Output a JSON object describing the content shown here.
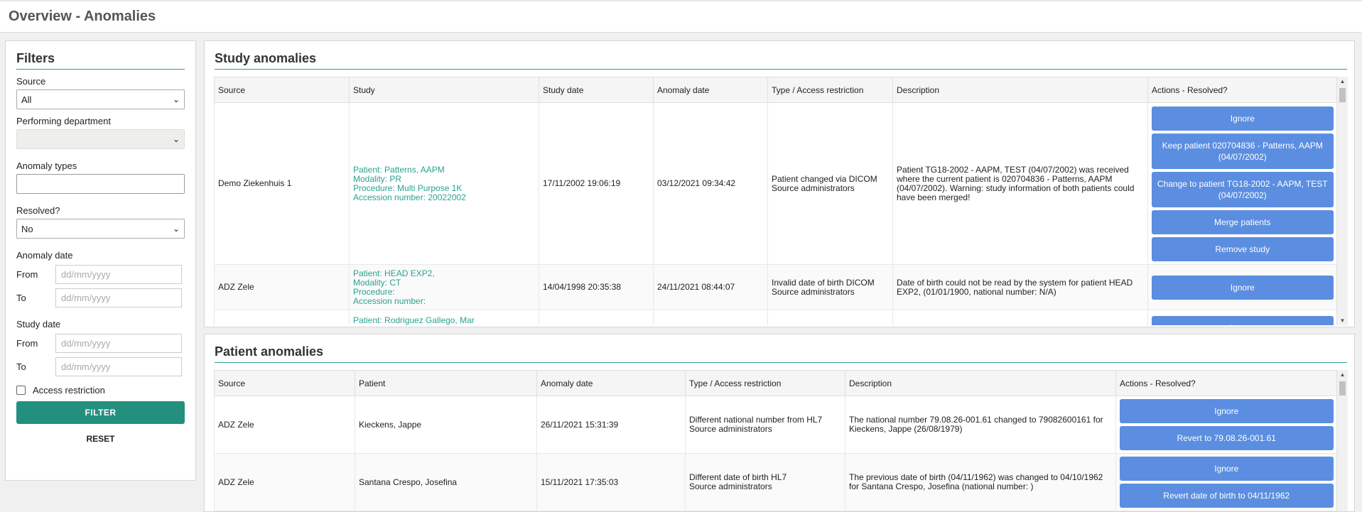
{
  "header": {
    "title": "Overview - Anomalies"
  },
  "filters": {
    "title": "Filters",
    "source_label": "Source",
    "source_value": "All",
    "department_label": "Performing department",
    "department_value": "",
    "anomaly_types_label": "Anomaly types",
    "resolved_label": "Resolved?",
    "resolved_value": "No",
    "anomaly_date_label": "Anomaly date",
    "study_date_label": "Study date",
    "from_label": "From",
    "to_label": "To",
    "date_placeholder": "dd/mm/yyyy",
    "access_restriction_label": "Access restriction",
    "filter_button": "FILTER",
    "reset_button": "RESET"
  },
  "study_anomalies": {
    "title": "Study anomalies",
    "columns": [
      "Source",
      "Study",
      "Study date",
      "Anomaly date",
      "Type / Access restriction",
      "Description",
      "Actions - Resolved?"
    ],
    "rows": [
      {
        "source": "Demo Ziekenhuis 1",
        "patient": "Patient: Patterns, AAPM",
        "modality": "Modality: PR",
        "procedure": "Procedure: Multi Purpose 1K",
        "accession": "Accession number: 20022002",
        "study_date": "17/11/2002 19:06:19",
        "anomaly_date": "03/12/2021 09:34:42",
        "type": "Patient changed via DICOM",
        "access": "Source administrators",
        "description": "Patient TG18-2002 - AAPM, TEST (04/07/2002) was received where the current patient is 020704836 - Patterns, AAPM (04/07/2002). Warning: study information of both patients could have been merged!",
        "actions": [
          "Ignore",
          "Keep patient 020704836 - Patterns, AAPM (04/07/2002)",
          "Change to patient TG18-2002 - AAPM, TEST (04/07/2002)",
          "Merge patients",
          "Remove study"
        ]
      },
      {
        "source": "ADZ Zele",
        "patient": "Patient: HEAD EXP2,",
        "modality": "Modality: CT",
        "procedure": "Procedure:",
        "accession": "Accession number:",
        "study_date": "14/04/1998 20:35:38",
        "anomaly_date": "24/11/2021 08:44:07",
        "type": "Invalid date of birth DICOM",
        "access": "Source administrators",
        "description": "Date of birth could not be read by the system for patient HEAD EXP2, (01/01/1900, national number: N/A)",
        "actions": [
          "Ignore"
        ]
      },
      {
        "source": "",
        "patient": "Patient: Rodriguez Gallego, Mar",
        "modality": "",
        "procedure": "",
        "accession": "",
        "study_date": "",
        "anomaly_date": "",
        "type": "",
        "access": "",
        "description": "",
        "actions": [
          "Ignore"
        ]
      }
    ]
  },
  "patient_anomalies": {
    "title": "Patient anomalies",
    "columns": [
      "Source",
      "Patient",
      "Anomaly date",
      "Type / Access restriction",
      "Description",
      "Actions - Resolved?"
    ],
    "rows": [
      {
        "source": "ADZ Zele",
        "patient": "Kieckens, Jappe",
        "anomaly_date": "26/11/2021 15:31:39",
        "type": "Different national number from HL7",
        "access": "Source administrators",
        "description": "The national number 79.08.26-001.61 changed to 79082600161 for Kieckens, Jappe (26/08/1979)",
        "actions": [
          "Ignore",
          "Revert to 79.08.26-001.61"
        ]
      },
      {
        "source": "ADZ Zele",
        "patient": "Santana Crespo, Josefina",
        "anomaly_date": "15/11/2021 17:35:03",
        "type": "Different date of birth HL7",
        "access": "Source administrators",
        "description": "The previous date of birth (04/11/1962) was changed to 04/10/1962 for Santana Crespo, Josefina (national number: )",
        "actions": [
          "Ignore",
          "Revert date of birth to 04/11/1962"
        ]
      }
    ]
  },
  "colors": {
    "accent": "#2a9d8f",
    "action_button": "#5b8ee0",
    "link_text": "#2aa28f"
  }
}
